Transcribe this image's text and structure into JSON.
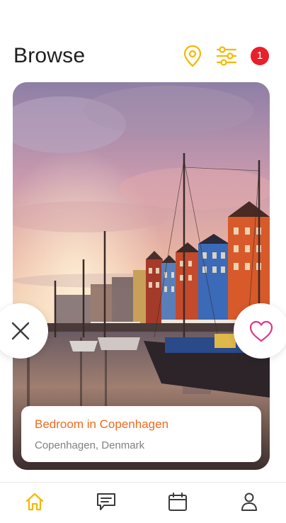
{
  "header": {
    "title": "Browse",
    "notification_count": "1"
  },
  "card": {
    "title": "Bedroom in Copenhagen",
    "location": "Copenhagen, Denmark"
  },
  "icons": {
    "location": "map-pin-icon",
    "filters": "sliders-icon",
    "dislike": "close-icon",
    "like": "heart-icon",
    "tab_home": "home-icon",
    "tab_messages": "chat-icon",
    "tab_calendar": "calendar-icon",
    "tab_profile": "user-icon"
  },
  "colors": {
    "accent": "#f5b800",
    "title_orange": "#f06a1c",
    "badge_red": "#e8202a",
    "like_pink": "#e0348a",
    "active_tab": "#f5b800",
    "inactive_tab": "#3a3a3a"
  }
}
